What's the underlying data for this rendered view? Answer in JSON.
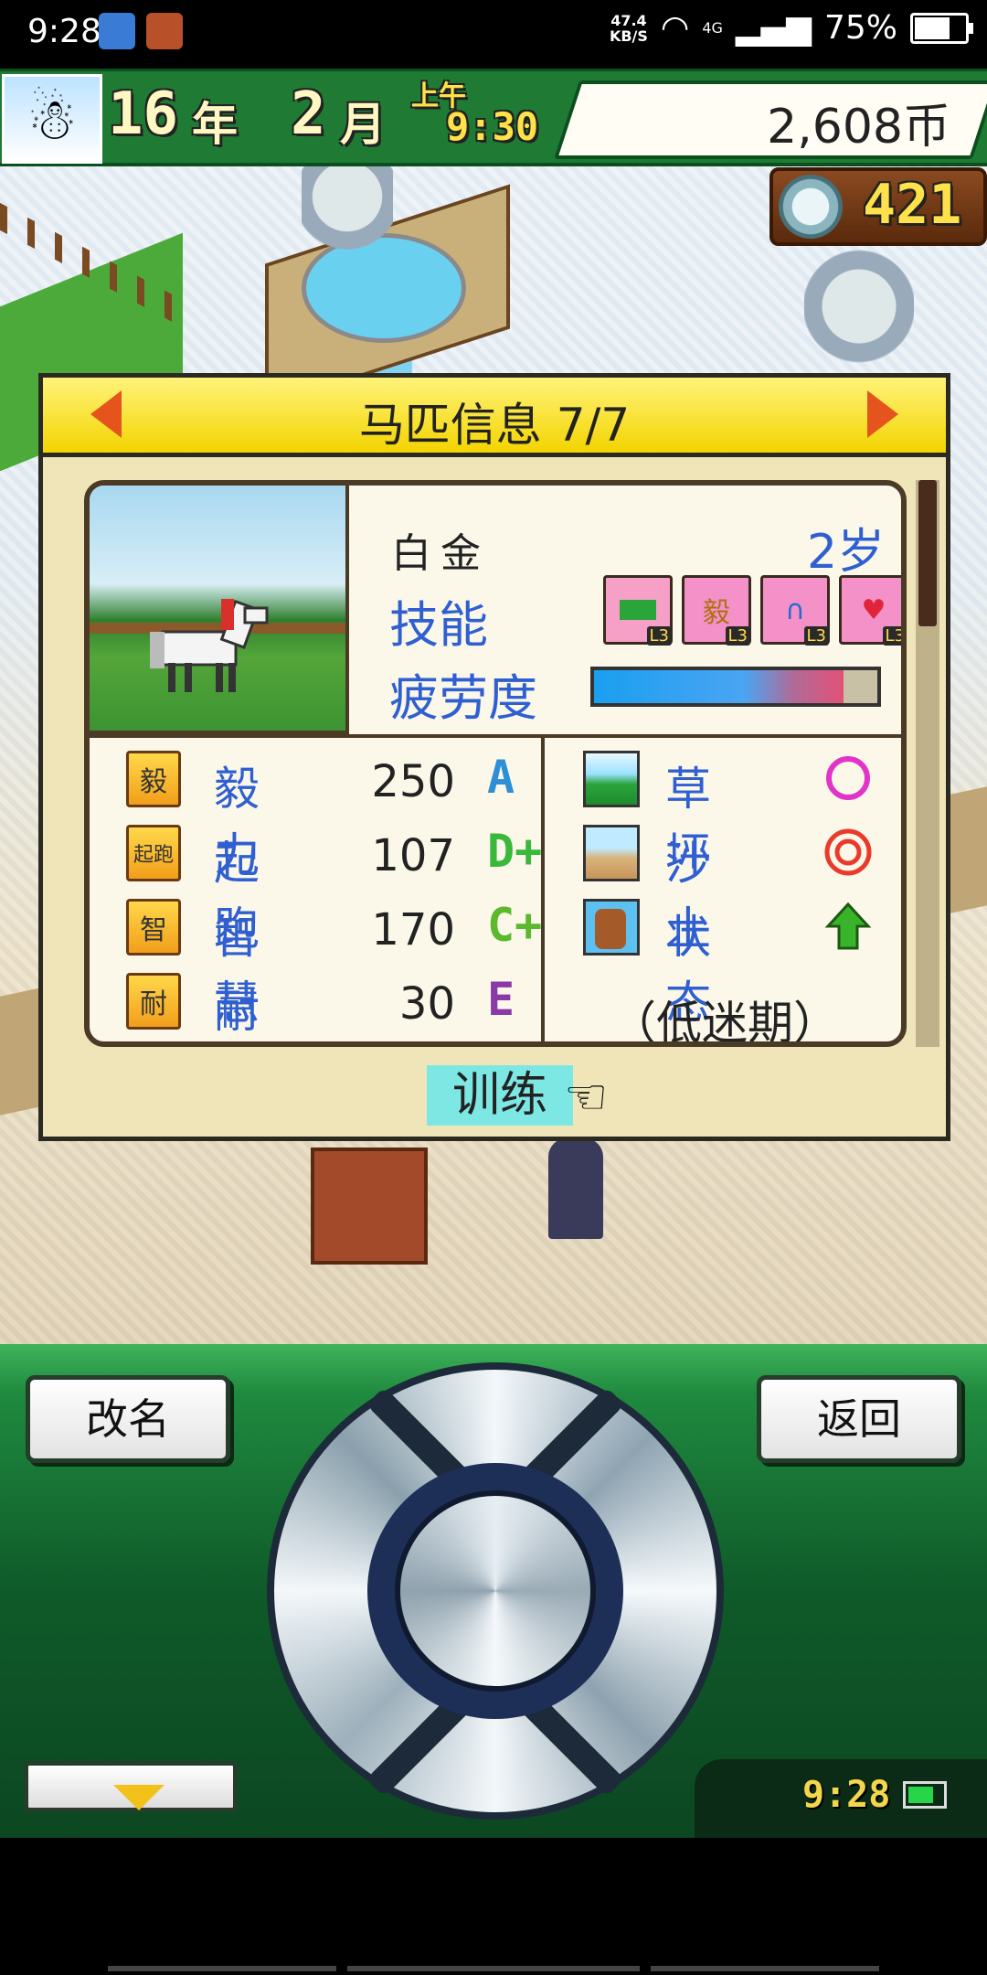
{
  "status_bar": {
    "time": "9:28",
    "network_speed": "47.4",
    "network_unit": "KB/S",
    "network_type": "4G",
    "battery_percent": "75%",
    "battery_level": 0.75
  },
  "hud": {
    "year_num": "16",
    "year_unit": "年",
    "month_num": "2",
    "month_unit": "月",
    "ampm": "上午",
    "game_time": "9:30",
    "money": "2,608币",
    "medals": "421"
  },
  "dialog": {
    "title": "马匹信息 7/7",
    "horse": {
      "name": "白金",
      "age": "2岁",
      "skills_label": "技能",
      "skills": [
        {
          "icon": "grass-skill-icon",
          "text": "",
          "level": "L3"
        },
        {
          "icon": "grit-skill-icon",
          "text": "毅",
          "level": "L3"
        },
        {
          "icon": "horseshoe-skill-icon",
          "text": "∩",
          "level": "L3"
        },
        {
          "icon": "heart-skill-icon",
          "text": "♥",
          "level": "L3"
        }
      ],
      "fatigue_label": "疲劳度",
      "fatigue_level": 0.88
    },
    "stats": [
      {
        "badge": "毅",
        "name": "毅力",
        "value": "250",
        "grade": "A",
        "grade_color": "#2e8fd6"
      },
      {
        "badge": "起跑",
        "name": "起跑",
        "value": "107",
        "grade": "D+",
        "grade_color": "#39b83a"
      },
      {
        "badge": "智",
        "name": "智慧",
        "value": "170",
        "grade": "C+",
        "grade_color": "#5cb82d"
      },
      {
        "badge": "耐",
        "name": "耐力",
        "value": "30",
        "grade": "E",
        "grade_color": "#8a3aa8"
      }
    ],
    "surfaces": [
      {
        "name": "草坪",
        "mark": "circle",
        "color": "#e234c8"
      },
      {
        "name": "沙土",
        "mark": "double-circle",
        "color": "#ea3a2c"
      },
      {
        "name": "状态",
        "mark": "up-arrow",
        "color": "#39b42a"
      }
    ],
    "condition": "（低迷期）",
    "train_label": "训练"
  },
  "controller": {
    "rename_label": "改名",
    "back_label": "返回",
    "clock": "9:28"
  }
}
